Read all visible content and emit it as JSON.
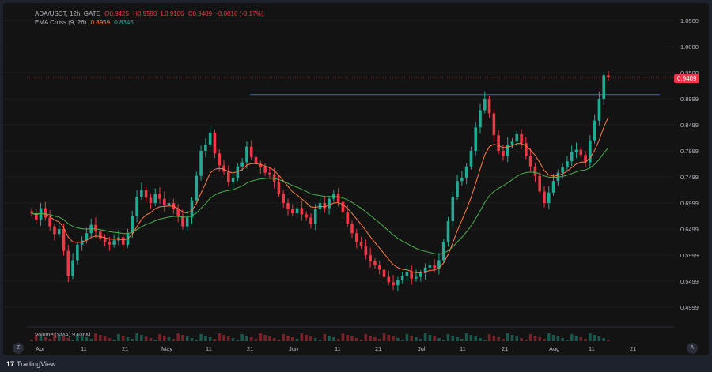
{
  "legend": {
    "symbol": "ADA/USDT, 12h, GATE",
    "open": "O0.9425",
    "high": "H0.9590",
    "low": "L0.9106",
    "close": "C0.9409",
    "change": "-0.0016 (-0.17%)",
    "indicator_name": "EMA Cross (9, 26)",
    "ema_fast": "0.8959",
    "ema_slow": "0.8345"
  },
  "price_axis": [
    "1.0500",
    "1.0000",
    "0.9500",
    "0.8999",
    "0.8499",
    "0.7999",
    "0.7499",
    "0.6999",
    "0.6499",
    "0.5999",
    "0.5499",
    "0.4999"
  ],
  "last_price": "0.9409",
  "time_axis": [
    "Apr",
    "11",
    "21",
    "May",
    "11",
    "21",
    "Jun",
    "11",
    "21",
    "Jul",
    "11",
    "21",
    "Aug",
    "11",
    "21"
  ],
  "volume_legend": "Volume (SMA) 9.036M",
  "buttons": {
    "goto": "Z",
    "auto": "A"
  },
  "brand": {
    "mark": "17",
    "name": "TradingView"
  },
  "colors": {
    "up": "#22ab94",
    "down": "#f23645",
    "ema_fast": "#ff7a45",
    "ema_slow": "#4caf50",
    "hline": "#2962ff"
  },
  "chart_data": {
    "type": "candlestick",
    "y_range": [
      0.4999,
      1.05
    ],
    "resistance_level": 0.908,
    "closes": [
      0.68,
      0.668,
      0.69,
      0.672,
      0.655,
      0.64,
      0.65,
      0.608,
      0.56,
      0.59,
      0.62,
      0.628,
      0.642,
      0.658,
      0.645,
      0.632,
      0.625,
      0.62,
      0.628,
      0.634,
      0.62,
      0.642,
      0.675,
      0.712,
      0.725,
      0.71,
      0.7,
      0.718,
      0.708,
      0.695,
      0.7,
      0.688,
      0.675,
      0.655,
      0.672,
      0.705,
      0.752,
      0.8,
      0.812,
      0.835,
      0.795,
      0.772,
      0.76,
      0.74,
      0.748,
      0.77,
      0.778,
      0.808,
      0.788,
      0.775,
      0.768,
      0.758,
      0.755,
      0.74,
      0.718,
      0.7,
      0.688,
      0.68,
      0.69,
      0.678,
      0.672,
      0.66,
      0.688,
      0.7,
      0.69,
      0.708,
      0.718,
      0.702,
      0.682,
      0.66,
      0.642,
      0.625,
      0.618,
      0.6,
      0.588,
      0.58,
      0.572,
      0.558,
      0.548,
      0.542,
      0.552,
      0.56,
      0.568,
      0.555,
      0.558,
      0.565,
      0.576,
      0.58,
      0.575,
      0.59,
      0.625,
      0.665,
      0.712,
      0.742,
      0.748,
      0.77,
      0.8,
      0.845,
      0.878,
      0.9,
      0.872,
      0.83,
      0.8,
      0.79,
      0.812,
      0.818,
      0.832,
      0.815,
      0.79,
      0.77,
      0.752,
      0.722,
      0.7,
      0.72,
      0.742,
      0.758,
      0.768,
      0.78,
      0.798,
      0.802,
      0.792,
      0.778,
      0.82,
      0.858,
      0.9,
      0.945,
      0.941
    ]
  }
}
